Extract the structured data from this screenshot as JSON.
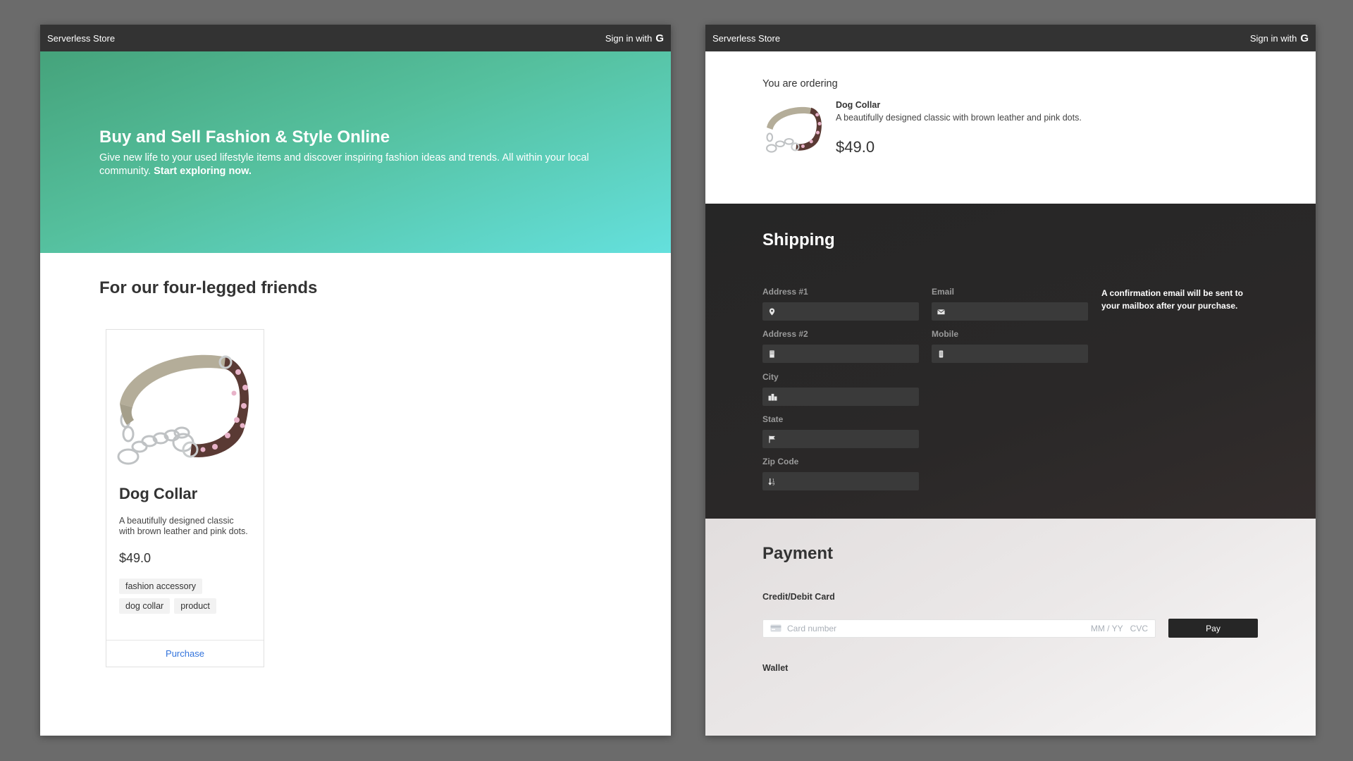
{
  "brand": "Serverless Store",
  "signin_label": "Sign in with",
  "signin_glyph": "G",
  "hero": {
    "title": "Buy and Sell Fashion & Style Online",
    "subtitle": "Give new life to your used lifestyle items and discover inspiring fashion ideas and trends. All within your local community.",
    "cta": "Start exploring now."
  },
  "section_title": "For our four-legged friends",
  "product": {
    "name": "Dog Collar",
    "description": "A beautifully designed classic with brown leather and pink dots.",
    "price": "$49.0",
    "tags": [
      "fashion accessory",
      "dog collar",
      "product"
    ],
    "action": "Purchase"
  },
  "order": {
    "label": "You are ordering",
    "name": "Dog Collar",
    "description": "A beautifully designed classic with brown leather and pink dots.",
    "price": "$49.0"
  },
  "shipping": {
    "title": "Shipping",
    "fields": {
      "address1": "Address #1",
      "address2": "Address #2",
      "city": "City",
      "state": "State",
      "zip": "Zip Code",
      "email": "Email",
      "mobile": "Mobile"
    },
    "note": "A confirmation email will be sent to your mailbox after your purchase."
  },
  "payment": {
    "title": "Payment",
    "card_label": "Credit/Debit Card",
    "card_placeholder": "Card number",
    "expiry_placeholder": "MM / YY",
    "cvc_placeholder": "CVC",
    "pay_label": "Pay",
    "wallet_label": "Wallet"
  },
  "colors": {
    "navbar": "#333333",
    "hero_start": "#45a37b",
    "hero_end": "#64e0dd",
    "link": "#3273dc",
    "shipping_bg": "#262626",
    "pay_button": "#262626"
  }
}
